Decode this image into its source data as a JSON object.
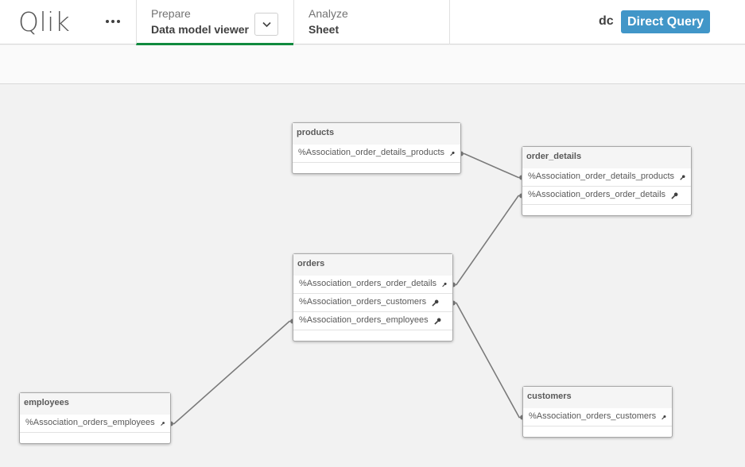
{
  "header": {
    "logo": "Qlik",
    "more_icon": "more-horizontal-icon",
    "tabs": [
      {
        "small": "Prepare",
        "big": "Data model viewer",
        "active": true
      },
      {
        "small": "Analyze",
        "big": "Sheet",
        "active": false
      }
    ],
    "dropdown_icon": "chevron-down-icon",
    "app_name": "dc",
    "badge": "Direct Query",
    "colors": {
      "active_tab_underline": "#108a3e",
      "badge_bg": "#4196c8"
    }
  },
  "model": {
    "tables": [
      {
        "name": "products",
        "fields": [
          "%Association_order_details_products"
        ]
      },
      {
        "name": "order_details",
        "fields": [
          "%Association_order_details_products",
          "%Association_orders_order_details"
        ]
      },
      {
        "name": "orders",
        "fields": [
          "%Association_orders_order_details",
          "%Association_orders_customers",
          "%Association_orders_employees"
        ]
      },
      {
        "name": "employees",
        "fields": [
          "%Association_orders_employees"
        ]
      },
      {
        "name": "customers",
        "fields": [
          "%Association_orders_customers"
        ]
      }
    ],
    "links": [
      {
        "from": "products.%Association_order_details_products",
        "to": "order_details.%Association_order_details_products"
      },
      {
        "from": "orders.%Association_orders_order_details",
        "to": "order_details.%Association_orders_order_details"
      },
      {
        "from": "orders.%Association_orders_customers",
        "to": "customers.%Association_orders_customers"
      },
      {
        "from": "employees.%Association_orders_employees",
        "to": "orders.%Association_orders_employees"
      }
    ],
    "field_icon": "key-icon"
  }
}
